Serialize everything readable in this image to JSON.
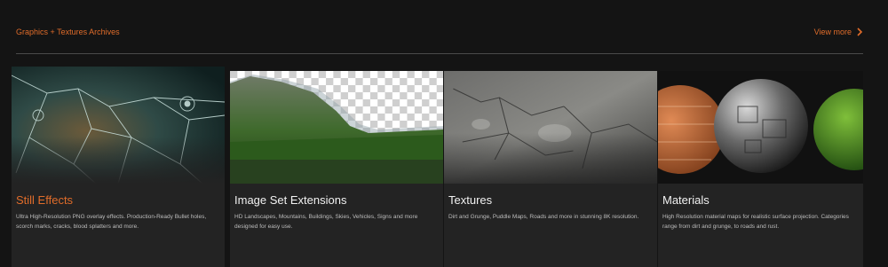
{
  "section": {
    "title": "Graphics + Textures Archives",
    "view_more": "View more",
    "accent": "#e06c2a"
  },
  "cards": [
    {
      "title": "Still Effects",
      "description": "Ultra High-Resolution PNG overlay effects. Production-Ready Bullet holes, scorch marks, cracks, blood splatters and more.",
      "thumbnail": "broken-glass-image",
      "active": true
    },
    {
      "title": "Image Set Extensions",
      "description": "HD Landscapes, Mountains, Buildings, Skies, Vehicles, Signs and more designed for easy use.",
      "thumbnail": "mountain-cutout-image"
    },
    {
      "title": "Textures",
      "description": "Dirt and Grunge, Puddle Maps, Roads and more in stunning 8K resolution.",
      "thumbnail": "cracked-concrete-image"
    },
    {
      "title": "Materials",
      "description": "High Resolution material maps for realistic surface projection. Categories range from dirt and grunge, to roads and rust.",
      "thumbnail": "material-spheres-image"
    }
  ]
}
